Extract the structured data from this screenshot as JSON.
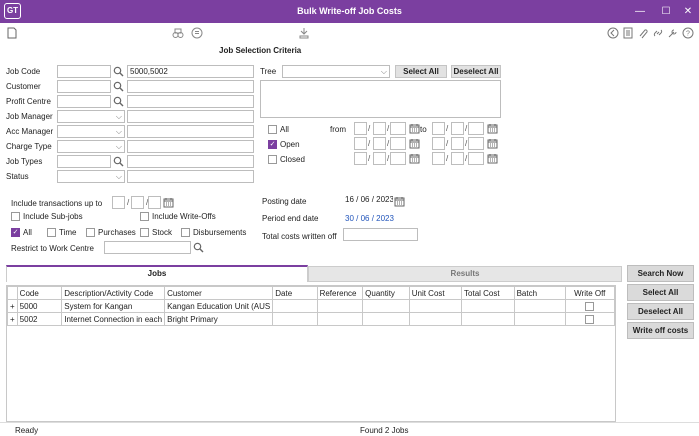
{
  "app": {
    "logo": "GT",
    "title": "Bulk Write-off Job Costs",
    "accent": "#7b3fa0"
  },
  "window_controls": {
    "minimize": "—",
    "maximize": "☐",
    "close": "✕"
  },
  "criteria": {
    "heading": "Job Selection Criteria",
    "job_code": {
      "label": "Job Code",
      "from": "",
      "to": "5000,5002"
    },
    "customer": {
      "label": "Customer",
      "value": ""
    },
    "profit_centre": {
      "label": "Profit Centre",
      "value": ""
    },
    "job_manager": {
      "label": "Job Manager",
      "value": ""
    },
    "acc_manager": {
      "label": "Acc Manager",
      "value": ""
    },
    "charge_type": {
      "label": "Charge Type",
      "value": ""
    },
    "job_types": {
      "label": "Job Types",
      "value": ""
    },
    "status": {
      "label": "Status",
      "value": ""
    }
  },
  "tree": {
    "label": "Tree",
    "value": "",
    "select_all": "Select All",
    "deselect_all": "Deselect All"
  },
  "status_filter": {
    "all": "All",
    "open": "Open",
    "closed": "Closed",
    "from": "from",
    "to": "to",
    "all_checked": false,
    "open_checked": true,
    "closed_checked": false
  },
  "options": {
    "include_up_to": "Include transactions up to",
    "include_subjobs": "Include Sub-jobs",
    "include_writeoffs": "Include Write-Offs",
    "types": [
      "All",
      "Time",
      "Purchases",
      "Stock",
      "Disbursements"
    ],
    "all_checked": true,
    "restrict": "Restrict to Work Centre"
  },
  "posting": {
    "posting_date_label": "Posting date",
    "posting_date": {
      "d": "16",
      "m": "06",
      "y": "2023"
    },
    "period_end_label": "Period end date",
    "period_end": {
      "d": "30",
      "m": "06",
      "y": "2023"
    },
    "total_written_off_label": "Total costs written off",
    "total_written_off": ""
  },
  "tabs": {
    "jobs": "Jobs",
    "results": "Results"
  },
  "grid": {
    "columns": [
      "Code",
      "Description/Activity Code",
      "Customer",
      "Date",
      "Reference",
      "Quantity",
      "Unit Cost",
      "Total Cost",
      "Batch",
      "Write Off"
    ],
    "rows": [
      {
        "expand": "+",
        "code": "5000",
        "desc": "System for Kangan",
        "customer": "Kangan Education Unit (AUS",
        "write_off": false
      },
      {
        "expand": "+",
        "code": "5002",
        "desc": "Internet Connection in each",
        "customer": "Bright Primary",
        "write_off": false
      }
    ]
  },
  "side_buttons": {
    "search_now": "Search Now",
    "select_all": "Select All",
    "deselect_all": "Deselect All",
    "write_off": "Write off costs"
  },
  "statusbar": {
    "left": "Ready",
    "center": "Found 2 Jobs"
  }
}
